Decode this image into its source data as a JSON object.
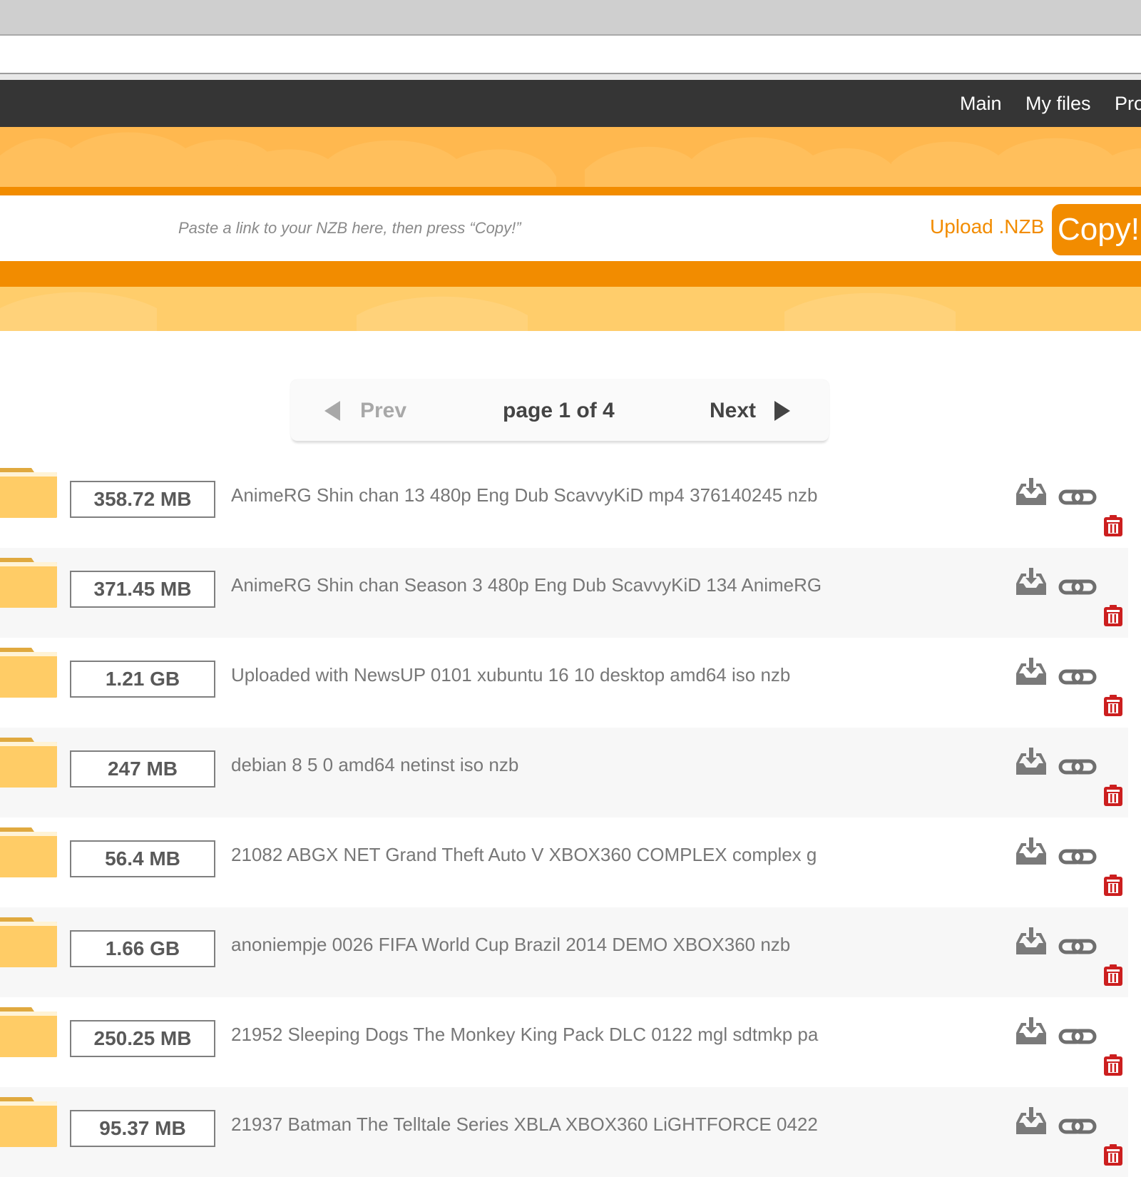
{
  "nav": {
    "items": [
      {
        "label": "Main"
      },
      {
        "label": "My files"
      },
      {
        "label": "Pro"
      }
    ]
  },
  "upload": {
    "placeholder": "Paste a link to your NZB here, then press “Copy!”",
    "upload_label": "Upload .NZB",
    "copy_label": "Copy!"
  },
  "pagination": {
    "prev_label": "Prev",
    "page_info": "page 1 of 4",
    "next_label": "Next"
  },
  "files": [
    {
      "size": "358.72 MB",
      "name": "AnimeRG Shin chan 13 480p Eng Dub ScavvyKiD mp4 376140245 nzb"
    },
    {
      "size": "371.45 MB",
      "name": "AnimeRG Shin chan Season 3 480p Eng Dub ScavvyKiD 134 AnimeRG"
    },
    {
      "size": "1.21 GB",
      "name": "Uploaded with NewsUP 0101 xubuntu 16 10 desktop amd64 iso nzb"
    },
    {
      "size": "247 MB",
      "name": "debian 8 5 0 amd64 netinst iso nzb"
    },
    {
      "size": "56.4 MB",
      "name": "21082 ABGX NET Grand Theft Auto V XBOX360 COMPLEX complex g"
    },
    {
      "size": "1.66 GB",
      "name": "anoniempje 0026 FIFA World Cup Brazil 2014 DEMO XBOX360 nzb"
    },
    {
      "size": "250.25 MB",
      "name": "21952 Sleeping Dogs The Monkey King Pack DLC 0122 mgl sdtmkp pa"
    },
    {
      "size": "95.37 MB",
      "name": "21937 Batman The Telltale Series XBLA XBOX360 LiGHTFORCE 0422"
    }
  ],
  "icons": {
    "folder": "folder-icon",
    "download": "download-icon",
    "link": "link-icon",
    "delete": "trash-icon",
    "prev": "triangle-left-icon",
    "next": "triangle-right-icon"
  },
  "colors": {
    "navbar": "#353535",
    "accent": "#f28c00",
    "banner": "#ffb84f",
    "banner_light": "#ffcd6b",
    "folder": "#ffcc66",
    "delete": "#cc1f1f"
  }
}
